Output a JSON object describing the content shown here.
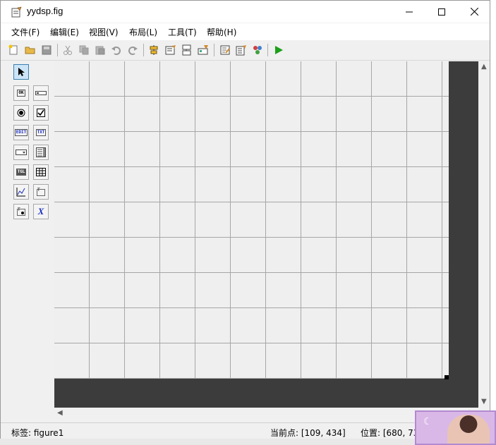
{
  "window": {
    "title": "yydsp.fig",
    "controls": {
      "minimize": "─",
      "maximize": "☐",
      "close": "✕"
    }
  },
  "menu": [
    {
      "label": "文件(F)"
    },
    {
      "label": "编辑(E)"
    },
    {
      "label": "视图(V)"
    },
    {
      "label": "布局(L)"
    },
    {
      "label": "工具(T)"
    },
    {
      "label": "帮助(H)"
    }
  ],
  "toolbar": {
    "buttons": [
      "new-file-icon",
      "open-folder-icon",
      "save-icon",
      "cut-icon",
      "copy-icon",
      "paste-icon",
      "undo-icon",
      "redo-icon",
      "align-icon",
      "menu-editor-icon",
      "tab-order-icon",
      "toolbar-editor-icon",
      "editor-icon",
      "property-inspector-icon",
      "object-browser-icon",
      "run-icon"
    ]
  },
  "palette": [
    {
      "name": "select-tool",
      "glyph": "➤"
    },
    {
      "name": "push-button-tool",
      "glyph": "OK"
    },
    {
      "name": "slider-tool",
      "glyph": ""
    },
    {
      "name": "radio-button-tool",
      "glyph": "◉"
    },
    {
      "name": "checkbox-tool",
      "glyph": "☑"
    },
    {
      "name": "edit-text-tool",
      "glyph": "EDIT"
    },
    {
      "name": "static-text-tool",
      "glyph": "TXT"
    },
    {
      "name": "popup-menu-tool",
      "glyph": ""
    },
    {
      "name": "listbox-tool",
      "glyph": ""
    },
    {
      "name": "toggle-button-tool",
      "glyph": "TGL"
    },
    {
      "name": "table-tool",
      "glyph": ""
    },
    {
      "name": "axes-tool",
      "glyph": ""
    },
    {
      "name": "panel-tool",
      "glyph": ""
    },
    {
      "name": "button-group-tool",
      "glyph": ""
    },
    {
      "name": "activex-tool",
      "glyph": "X"
    }
  ],
  "status": {
    "tag": "标签: figure1",
    "current_point": "当前点:  [109, 434]",
    "position": "位置: [680, 73"
  },
  "colors": {
    "canvas_bg": "#efefef",
    "grid_line": "#a6a6a6",
    "figure_bg": "#3c3c3c",
    "run_green": "#1aa01a",
    "activex_blue": "#1a2fc0"
  }
}
